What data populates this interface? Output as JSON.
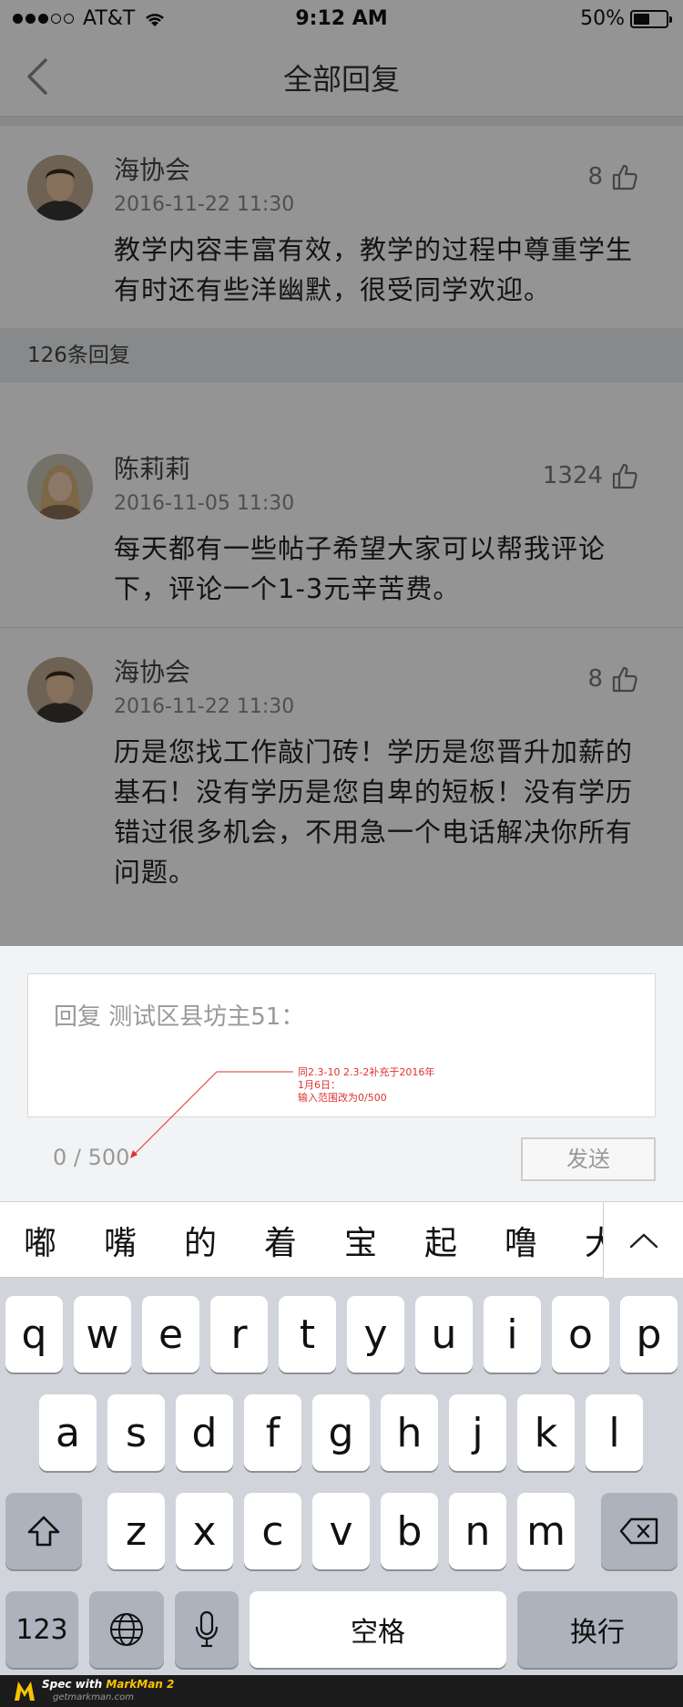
{
  "status_bar": {
    "carrier": "AT&T",
    "time": "9:12 AM",
    "battery": "50%"
  },
  "nav": {
    "title": "全部回复"
  },
  "main_comment": {
    "author": "海协会",
    "time": "2016-11-22 11:30",
    "likes": "8",
    "text": "教学内容丰富有效，教学的过程中尊重学生有时还有些洋幽默，很受同学欢迎。"
  },
  "reply_count": "126条回复",
  "replies": [
    {
      "author": "陈莉莉",
      "time": "2016-11-05 11:30",
      "likes": "1324",
      "text": "每天都有一些帖子希望大家可以帮我评论下，评论一个1-3元辛苦费。"
    },
    {
      "author": "海协会",
      "time": "2016-11-22 11:30",
      "likes": "8",
      "text": "历是您找工作敲门砖！学历是您晋升加薪的基石！没有学历是您自卑的短板！没有学历错过很多机会，不用急一个电话解决你所有问题。"
    }
  ],
  "reply_panel": {
    "placeholder": "回复 测试区县坊主51：",
    "char_count": "0 / 500",
    "send_label": "发送",
    "annotation": [
      "同2.3-10 2.3-2补充于2016年",
      "1月6日：",
      "输入范围改为0/500"
    ]
  },
  "candidates": [
    "嘟",
    "嘴",
    "的",
    "着",
    "宝",
    "起",
    "噜",
    "大"
  ],
  "keyboard": {
    "row1": [
      "q",
      "w",
      "e",
      "r",
      "t",
      "y",
      "u",
      "i",
      "o",
      "p"
    ],
    "row2": [
      "a",
      "s",
      "d",
      "f",
      "g",
      "h",
      "j",
      "k",
      "l"
    ],
    "row3": [
      "z",
      "x",
      "c",
      "v",
      "b",
      "n",
      "m"
    ],
    "numbers_label": "123",
    "space_label": "空格",
    "return_label": "换行"
  },
  "footer": {
    "spec_text": "Spec with ",
    "brand": "MarkMan 2",
    "url": "getmarkman.com"
  },
  "colors": {
    "annotation": "#e23030",
    "brand_yellow": "#f7c400"
  }
}
